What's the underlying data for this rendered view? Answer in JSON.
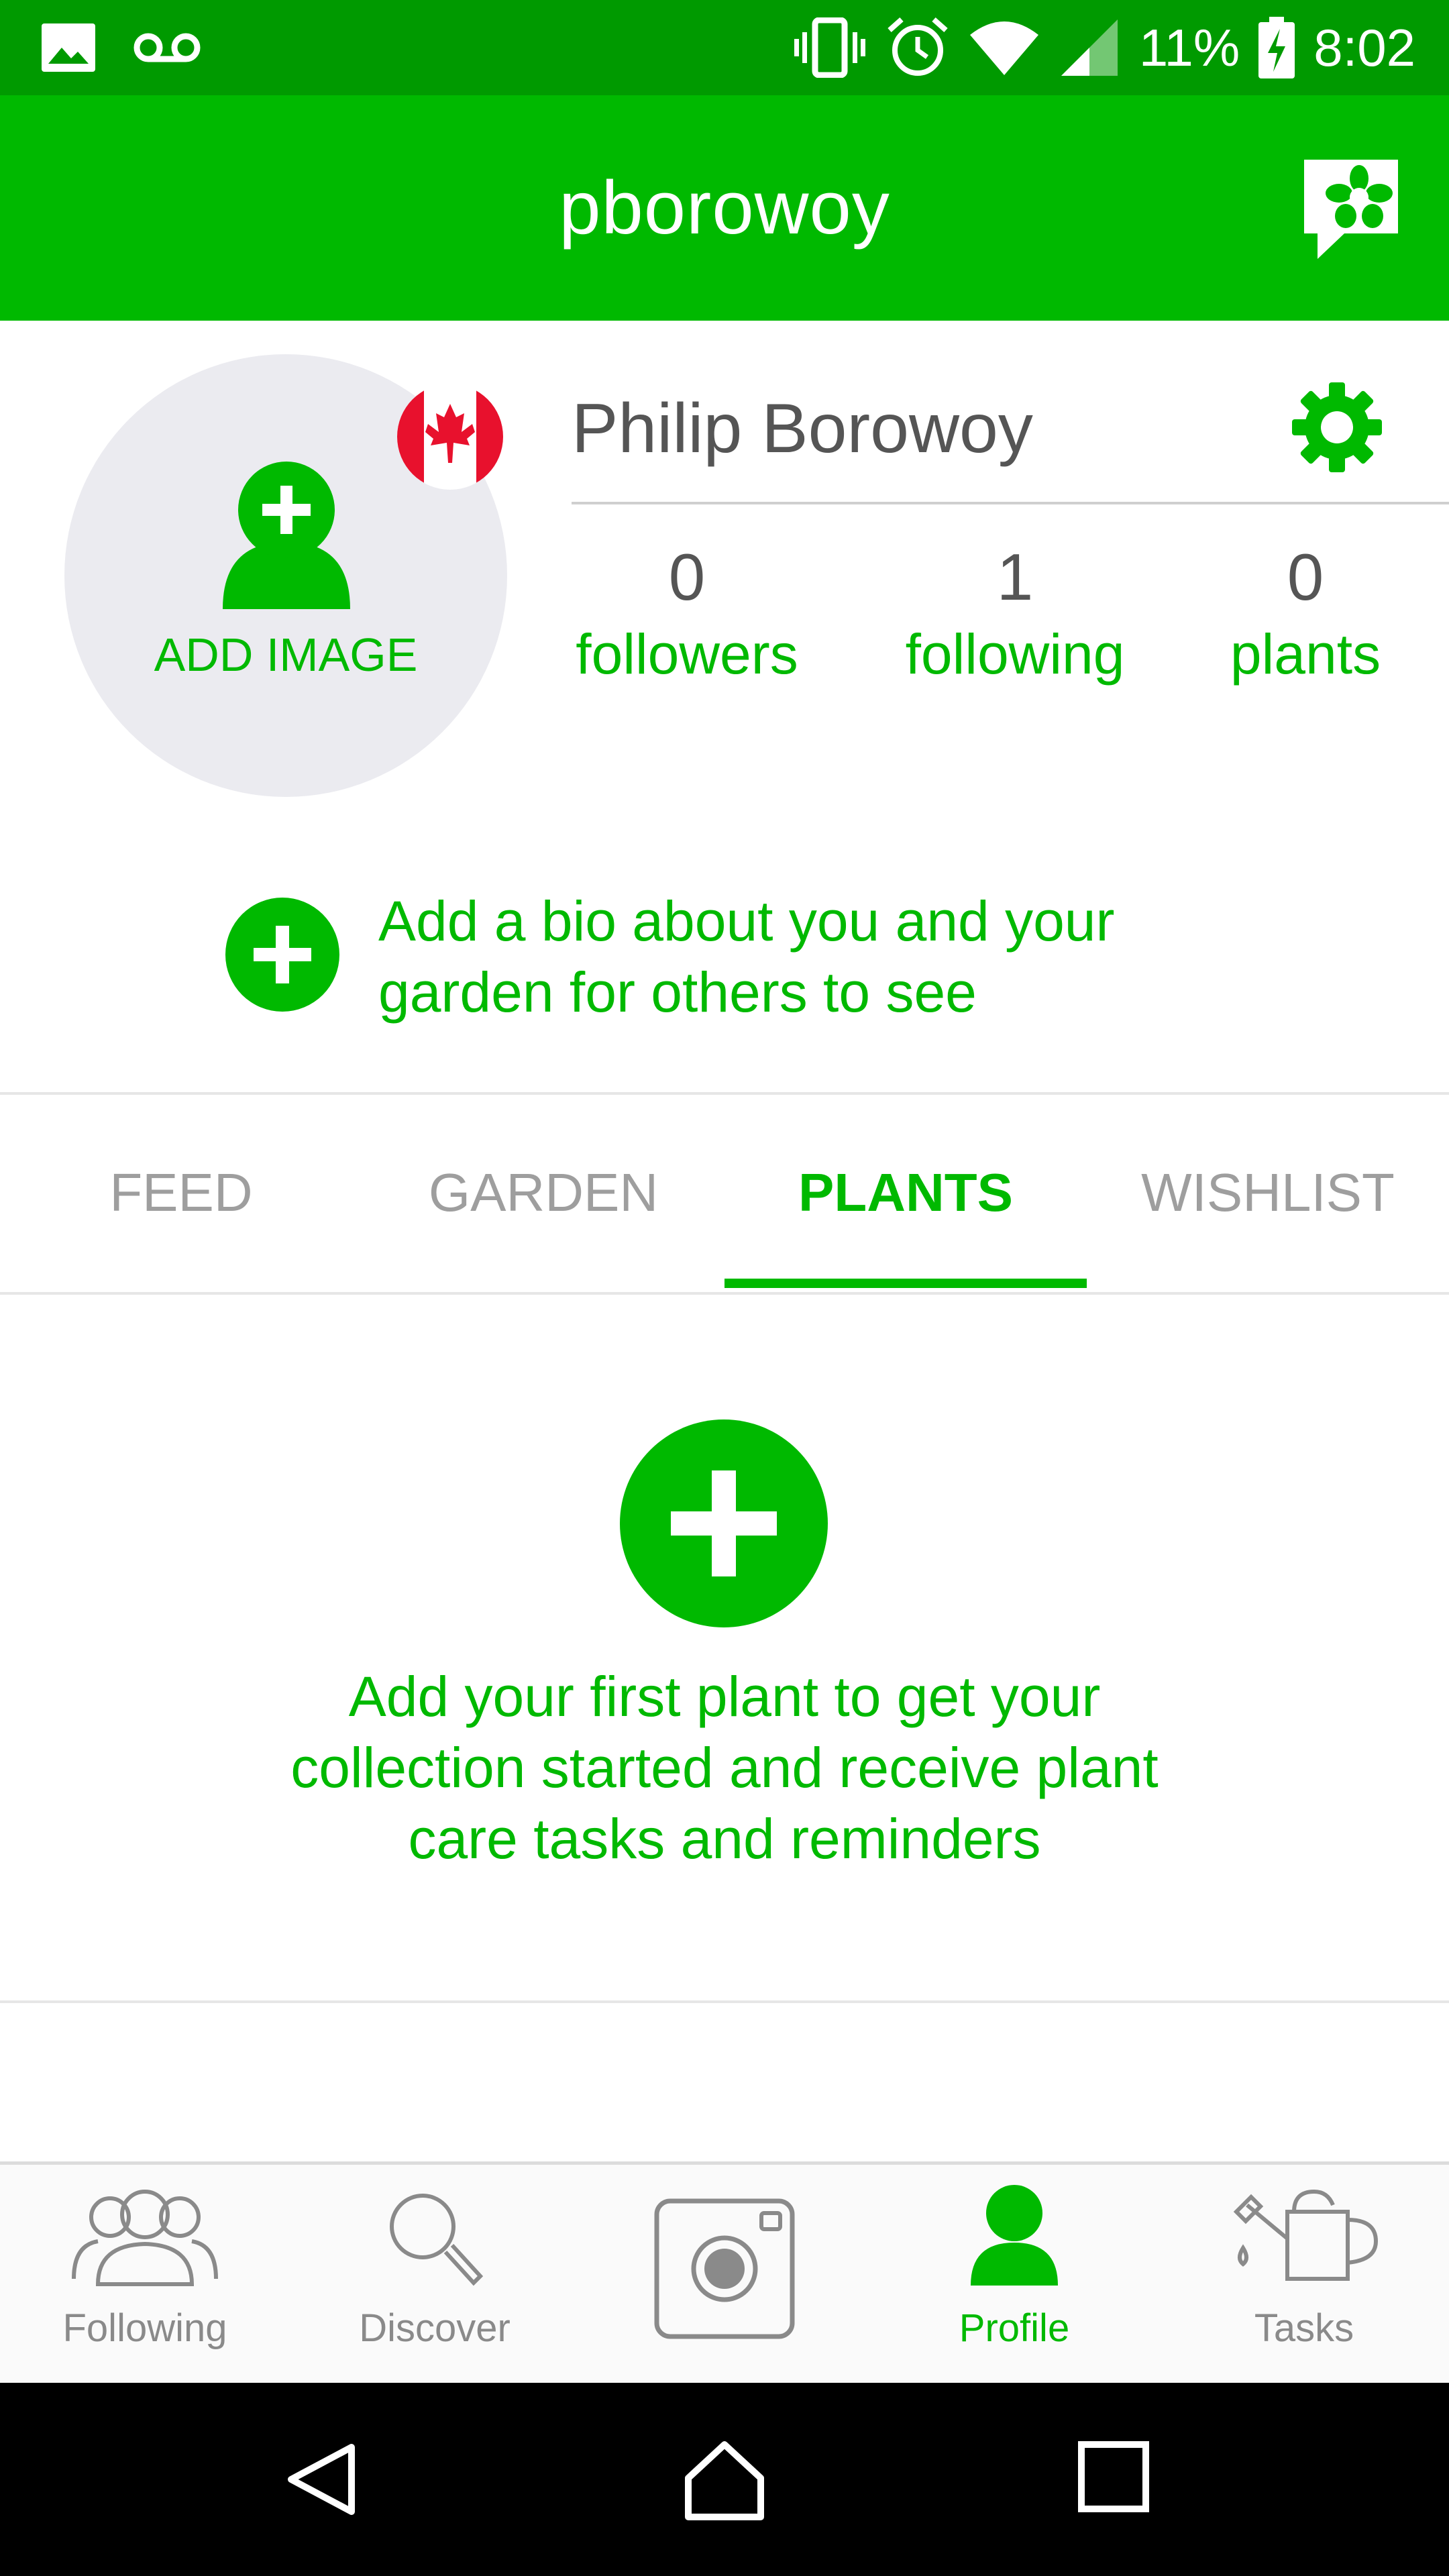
{
  "status_bar": {
    "battery": "11%",
    "time": "8:02"
  },
  "app_bar": {
    "title": "pborowoy"
  },
  "profile": {
    "add_image_label": "ADD IMAGE",
    "name": "Philip Borowoy",
    "stats": [
      {
        "value": "0",
        "label": "followers"
      },
      {
        "value": "1",
        "label": "following"
      },
      {
        "value": "0",
        "label": "plants"
      }
    ],
    "bio_prompt_line1": "Add a bio about you and your",
    "bio_prompt_line2": "garden for others to see"
  },
  "tabs": [
    {
      "label": "FEED",
      "active": false
    },
    {
      "label": "GARDEN",
      "active": false
    },
    {
      "label": "PLANTS",
      "active": true
    },
    {
      "label": "WISHLIST",
      "active": false
    }
  ],
  "empty_state": {
    "line1": "Add your first plant to get your",
    "line2": "collection started and receive plant",
    "line3": "care tasks and reminders"
  },
  "bottom_nav": [
    {
      "label": "Following",
      "icon": "people-icon",
      "active": false
    },
    {
      "label": "Discover",
      "icon": "search-icon",
      "active": false
    },
    {
      "label": "",
      "icon": "camera-icon",
      "active": false
    },
    {
      "label": "Profile",
      "icon": "person-icon",
      "active": true
    },
    {
      "label": "Tasks",
      "icon": "watering-can-icon",
      "active": false
    }
  ],
  "colors": {
    "brand_green": "#00b900",
    "status_bar_green": "#009a00",
    "inactive_gray": "#9e9e9e"
  }
}
